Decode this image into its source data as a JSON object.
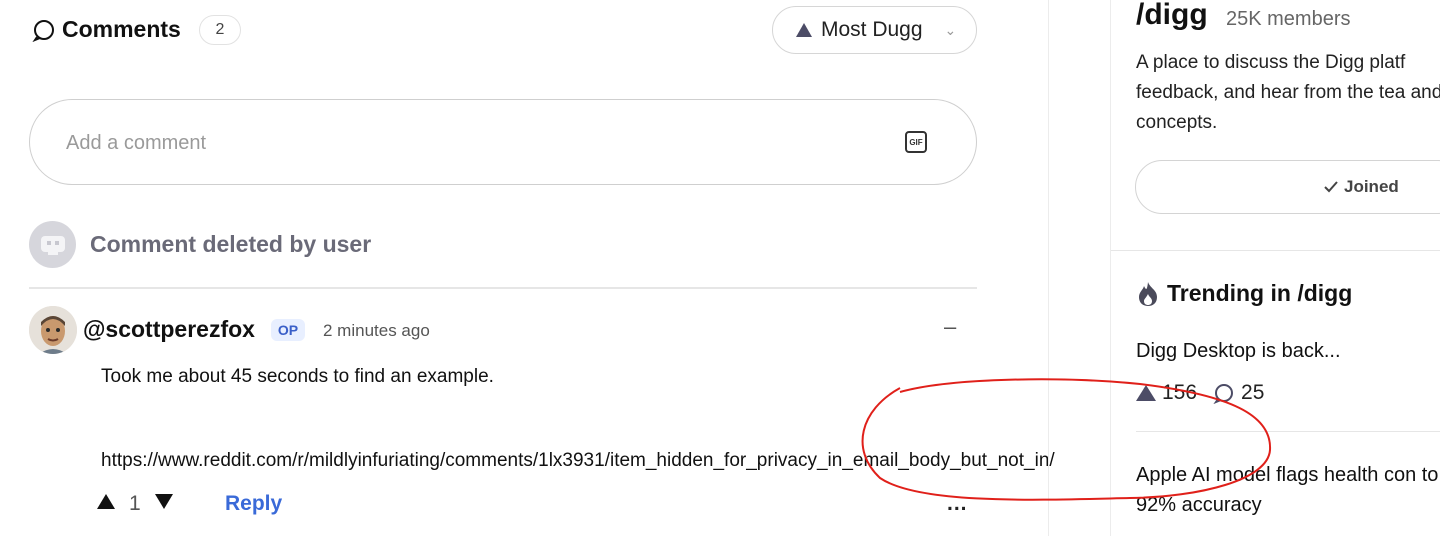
{
  "comments": {
    "title": "Comments",
    "count": "2",
    "sort_label": "Most Dugg",
    "input_placeholder": "Add a comment",
    "gif_label": "GIF",
    "deleted_text": "Comment deleted by user",
    "items": [
      {
        "author": "@scottperezfox",
        "badge": "OP",
        "time": "2 minutes ago",
        "body_line1": "Took me about 45 seconds to find an example.",
        "body_line2": "https://www.reddit.com/r/mildlyinfuriating/comments/1lx3931/item_hidden_for_privacy_in_email_body_but_not_in/",
        "votes": "1",
        "reply_label": "Reply",
        "collapse_symbol": "–",
        "more_symbol": "..."
      }
    ]
  },
  "sidebar": {
    "community_name": "/digg",
    "members": "25K members",
    "description": "A place to discuss the Digg platf feedback, and hear from the tea and concepts.",
    "join_label": "Joined",
    "trending_title": "Trending in /digg",
    "trending": [
      {
        "title": "Digg Desktop is back...",
        "upvotes": "156",
        "comments": "25"
      },
      {
        "title": "Apple AI model flags health con to 92% accuracy"
      }
    ]
  },
  "colors": {
    "accent_link": "#3a6ad8",
    "annotation": "#e0201a",
    "op_badge_bg": "#e8efff"
  }
}
